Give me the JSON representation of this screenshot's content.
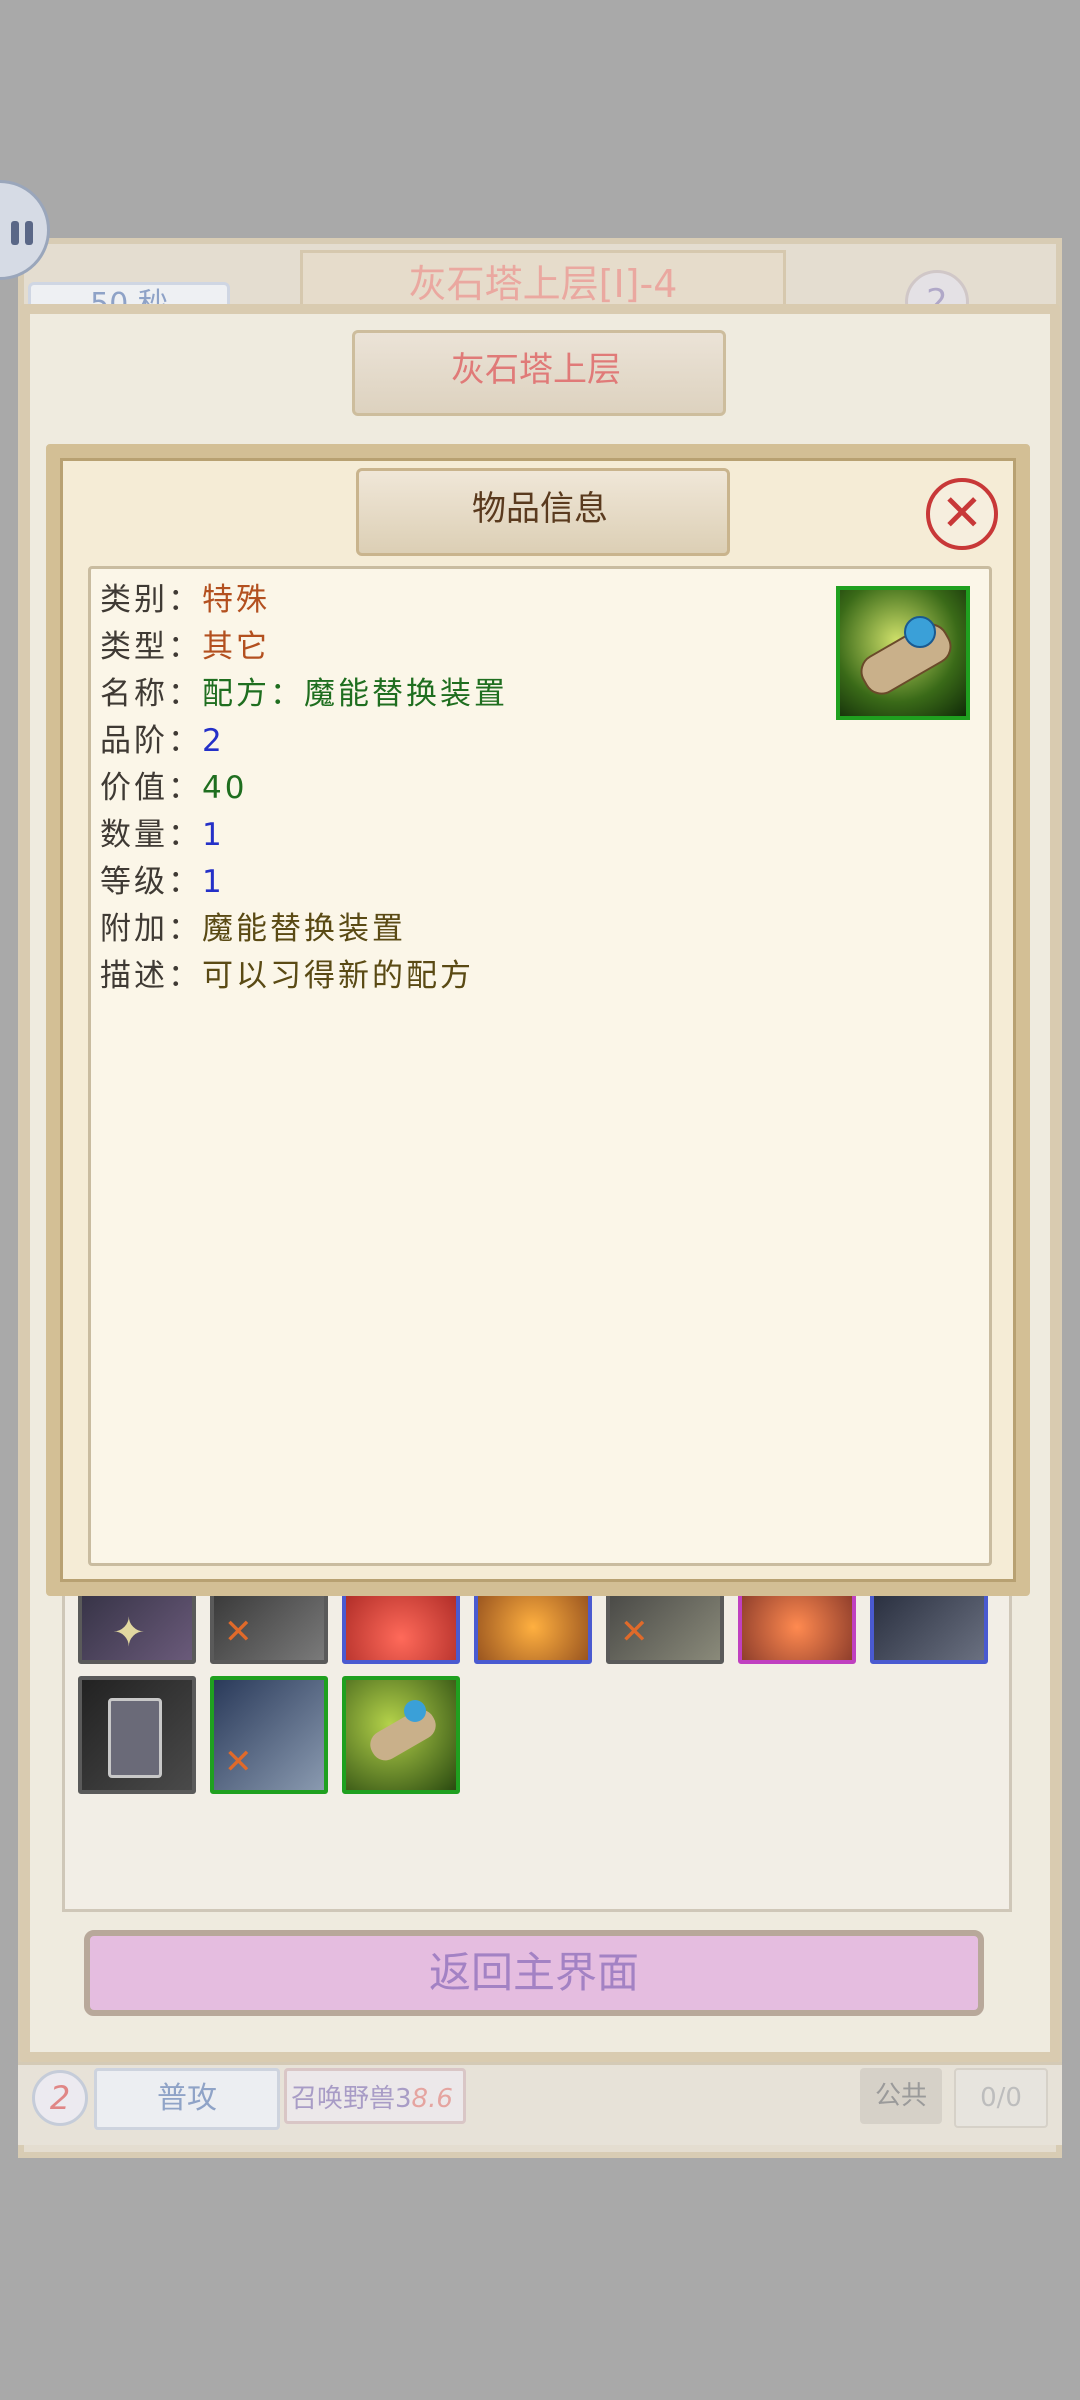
{
  "battle": {
    "timer": "50 秒",
    "title": "灰石塔上层[Ⅰ]-4",
    "round": "2"
  },
  "dungeon": {
    "title": "灰石塔上层",
    "return_button": "返回主界面"
  },
  "inventory": {
    "row1": [
      {
        "name": "amulet",
        "border": "#5a5a5a",
        "crossed": false
      },
      {
        "name": "dark-armor",
        "border": "#5a5a5a",
        "crossed": true
      },
      {
        "name": "red-potion",
        "border": "#4a5ad0",
        "crossed": false
      },
      {
        "name": "fire-sword",
        "border": "#4a5ad0",
        "crossed": false
      },
      {
        "name": "crossbow",
        "border": "#5a5a5a",
        "crossed": true
      },
      {
        "name": "beast-claw",
        "border": "#c040c0",
        "crossed": false
      },
      {
        "name": "dark-helm",
        "border": "#4a5ad0",
        "crossed": false
      }
    ],
    "row2": [
      {
        "name": "beer-mug",
        "border": "#5a5a5a",
        "crossed": false
      },
      {
        "name": "blue-armor",
        "border": "#1fa01f",
        "crossed": true
      },
      {
        "name": "recipe-scroll",
        "border": "#1fa01f",
        "crossed": false
      }
    ]
  },
  "bottom_bar": {
    "round": "2",
    "attack": "普攻",
    "summon": "召唤野兽3",
    "summon_cd": "8.6",
    "public": "公共",
    "count": "0/0"
  },
  "dialog": {
    "title": "物品信息",
    "close_label": "✕",
    "rows": [
      {
        "label": "类别：",
        "value": "特殊"
      },
      {
        "label": "类型：",
        "value": "其它"
      },
      {
        "label": "名称：",
        "value": "配方：魔能替换装置"
      },
      {
        "label": "品阶：",
        "value": "2"
      },
      {
        "label": "价值：",
        "value": "40"
      },
      {
        "label": "数量：",
        "value": "1"
      },
      {
        "label": "等级：",
        "value": "1"
      },
      {
        "label": "附加：",
        "value": "魔能替换装置"
      },
      {
        "label": "描述：",
        "value": "可以习得新的配方"
      }
    ],
    "item_icon": "recipe-scroll-icon"
  },
  "colors": {
    "quality_green": "#1fa01f",
    "quality_blue": "#4a5ad0",
    "quality_purple": "#c040c0",
    "close_red": "#c83838"
  }
}
